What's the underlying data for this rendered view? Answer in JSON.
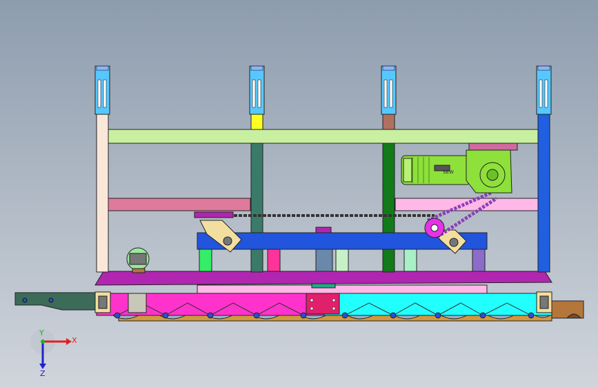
{
  "viewport": {
    "background_top": "#8d9cae",
    "background_bottom": "#d0d5dc"
  },
  "model": {
    "motor_nameplate": "SEW",
    "colors": {
      "green_motor": "#8ee03a",
      "top_beam": "#c8f0a0",
      "magenta_base": "#ff33cc",
      "cyan_base": "#22ffff",
      "purple_rail": "#b026b0",
      "blue_beam": "#2255dd",
      "blue_post": "#1f5fe0",
      "pink_beam": "#e07a9c",
      "light_pink_beam": "#ffb8e8",
      "cream_post": "#fbe7d8",
      "teal_post": "#3a7a68",
      "dark_green_post": "#137a1a",
      "chain": "#8a3fb8",
      "sprocket": "#e633e6",
      "bracket_tan": "#f2dfa0",
      "bronze_plate": "#b5763c"
    }
  },
  "triad": {
    "x_label": "X",
    "y_label": "Y",
    "z_label": "Z",
    "x_color": "#e02020",
    "y_color": "#20b020",
    "z_color": "#2020d0"
  }
}
